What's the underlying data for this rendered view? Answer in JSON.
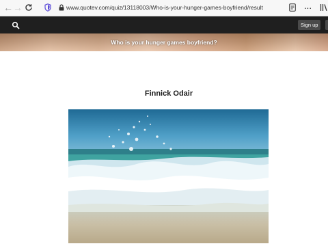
{
  "browser": {
    "url": "www.quotev.com/quiz/13118003/Who-is-your-hunger-games-boyfriend/result"
  },
  "site": {
    "signup_label": "Sign up"
  },
  "quiz": {
    "title": "Who is your hunger games boyfriend?",
    "result_name": "Finnick Odair"
  },
  "icons": {
    "back": "arrow-left-icon",
    "forward": "arrow-right-icon",
    "reload": "reload-icon",
    "tracking": "shield-icon",
    "lock": "lock-icon",
    "reader": "reader-view-icon",
    "menu": "more-icon",
    "library": "library-icon",
    "search": "search-icon"
  }
}
